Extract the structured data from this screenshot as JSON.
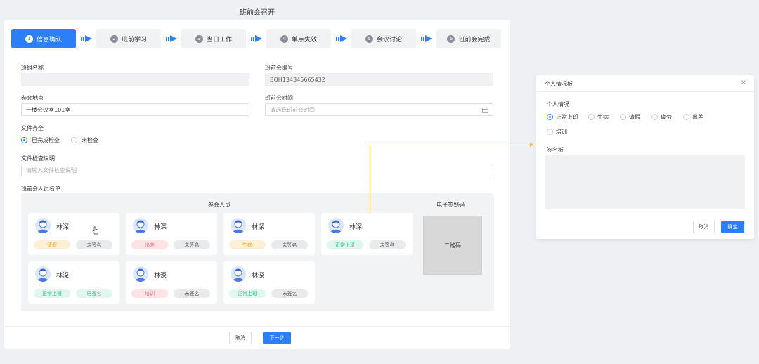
{
  "page_title": "班前会召开",
  "steps": [
    {
      "num": "1",
      "label": "信息确认"
    },
    {
      "num": "2",
      "label": "班前学习"
    },
    {
      "num": "3",
      "label": "当日工作"
    },
    {
      "num": "4",
      "label": "单点失效"
    },
    {
      "num": "5",
      "label": "会议讨论"
    },
    {
      "num": "6",
      "label": "班前会完成"
    }
  ],
  "form": {
    "team_name_label": "班组名称",
    "team_name_value": "",
    "meeting_no_label": "班前会编号",
    "meeting_no_value": "BQH134345665432",
    "location_label": "参会地点",
    "location_value": "一楼会议室101室",
    "meeting_time_label": "班前会时间",
    "meeting_time_placeholder": "请选择班前会时间",
    "docs_label": "文件齐全",
    "docs_options": [
      "已完成检查",
      "未检查"
    ],
    "docs_note_label": "文件检查说明",
    "docs_note_placeholder": "请输入文件检查说明",
    "roster_label": "班前会人员名单"
  },
  "roster": {
    "participants_title": "参会人员",
    "qr_title": "电子签到码",
    "qr_label": "二维码",
    "people": [
      {
        "name": "林深",
        "status": "请假",
        "sign": "未签名"
      },
      {
        "name": "林深",
        "status": "出差",
        "sign": "未签名"
      },
      {
        "name": "林深",
        "status": "生病",
        "sign": "未签名"
      },
      {
        "name": "林深",
        "status": "正常上班",
        "sign": "未签名"
      },
      {
        "name": "林深",
        "status": "正常上班",
        "sign": "已签名"
      },
      {
        "name": "林深",
        "status": "培训",
        "sign": "未签名"
      },
      {
        "name": "林深",
        "status": "正常上班",
        "sign": "未签名"
      }
    ]
  },
  "footer": {
    "cancel": "取消",
    "next": "下一步"
  },
  "dialog": {
    "title": "个人情况板",
    "close_icon": "×",
    "situation_label": "个人情况",
    "options": [
      "正常上班",
      "生病",
      "请假",
      "疲劳",
      "出差",
      "培训"
    ],
    "signature_label": "签名板",
    "cancel": "取消",
    "confirm": "确定"
  },
  "colors": {
    "primary": "#2d7ff9",
    "connector": "#f5b53f",
    "tag_yellow": "#e6a23c",
    "tag_red": "#f26d7d",
    "tag_green": "#2fbf8a"
  }
}
